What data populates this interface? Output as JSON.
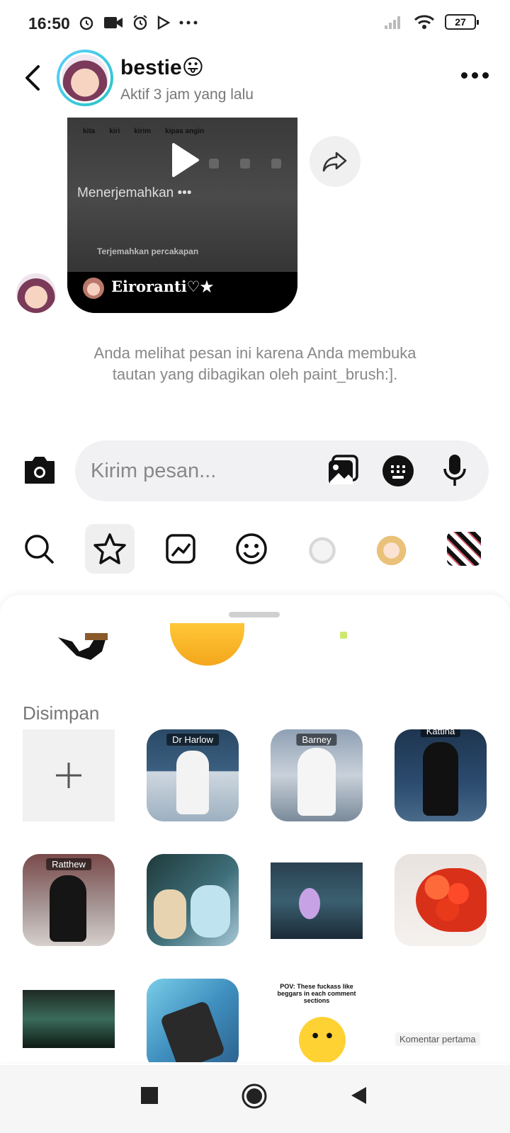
{
  "status_bar": {
    "time": "16:50",
    "left_icons": [
      "alarm-icon",
      "video-record-icon",
      "alarm-clock-icon",
      "play-store-icon",
      "more-dots-icon"
    ],
    "right_icons": [
      "signal-icon",
      "wifi-icon",
      "battery-icon"
    ],
    "battery_level": "27"
  },
  "header": {
    "name": "bestie😛",
    "status": "Aktif 3 jam yang lalu"
  },
  "shared_video": {
    "keyboard_words": [
      "kita",
      "kiri",
      "kirim",
      "kipas angin"
    ],
    "translating_text": "Menerjemahkan •••",
    "translate_convo_text": "Terjemahkan percakapan",
    "author": "Eiroranti♡★"
  },
  "info_note": "Anda melihat pesan ini karena Anda membuka tautan yang dibagikan oleh paint_brush:].",
  "composer": {
    "placeholder": "Kirim pesan..."
  },
  "sticker_tabs": [
    {
      "icon": "search-icon",
      "active": false
    },
    {
      "icon": "star-icon",
      "active": true
    },
    {
      "icon": "trending-icon",
      "active": false
    },
    {
      "icon": "smiley-icon",
      "active": false
    },
    {
      "icon": "cat-sticker-pack",
      "active": false
    },
    {
      "icon": "anime-sticker-pack",
      "active": false
    },
    {
      "icon": "panda-sticker-pack",
      "active": false
    }
  ],
  "saved": {
    "label": "Disimpan",
    "tiles": [
      {
        "label": ""
      },
      {
        "label": "Dr Harlow"
      },
      {
        "label": "Barney"
      },
      {
        "label": "Kattina"
      },
      {
        "label": "Ratthew"
      },
      {
        "label": ""
      },
      {
        "label": ""
      },
      {
        "label": ""
      },
      {
        "label": ""
      },
      {
        "label": ""
      },
      {
        "label": "POV: These fuckass like beggars in each comment sections"
      },
      {
        "label": "Komentar pertama"
      }
    ]
  },
  "nav_bar": {
    "buttons": [
      "recents-button",
      "home-button",
      "back-button"
    ]
  },
  "colors": {
    "accent_ring": "#29c3c3",
    "muted_text": "#888888",
    "composer_bg": "#f1f1f3"
  }
}
